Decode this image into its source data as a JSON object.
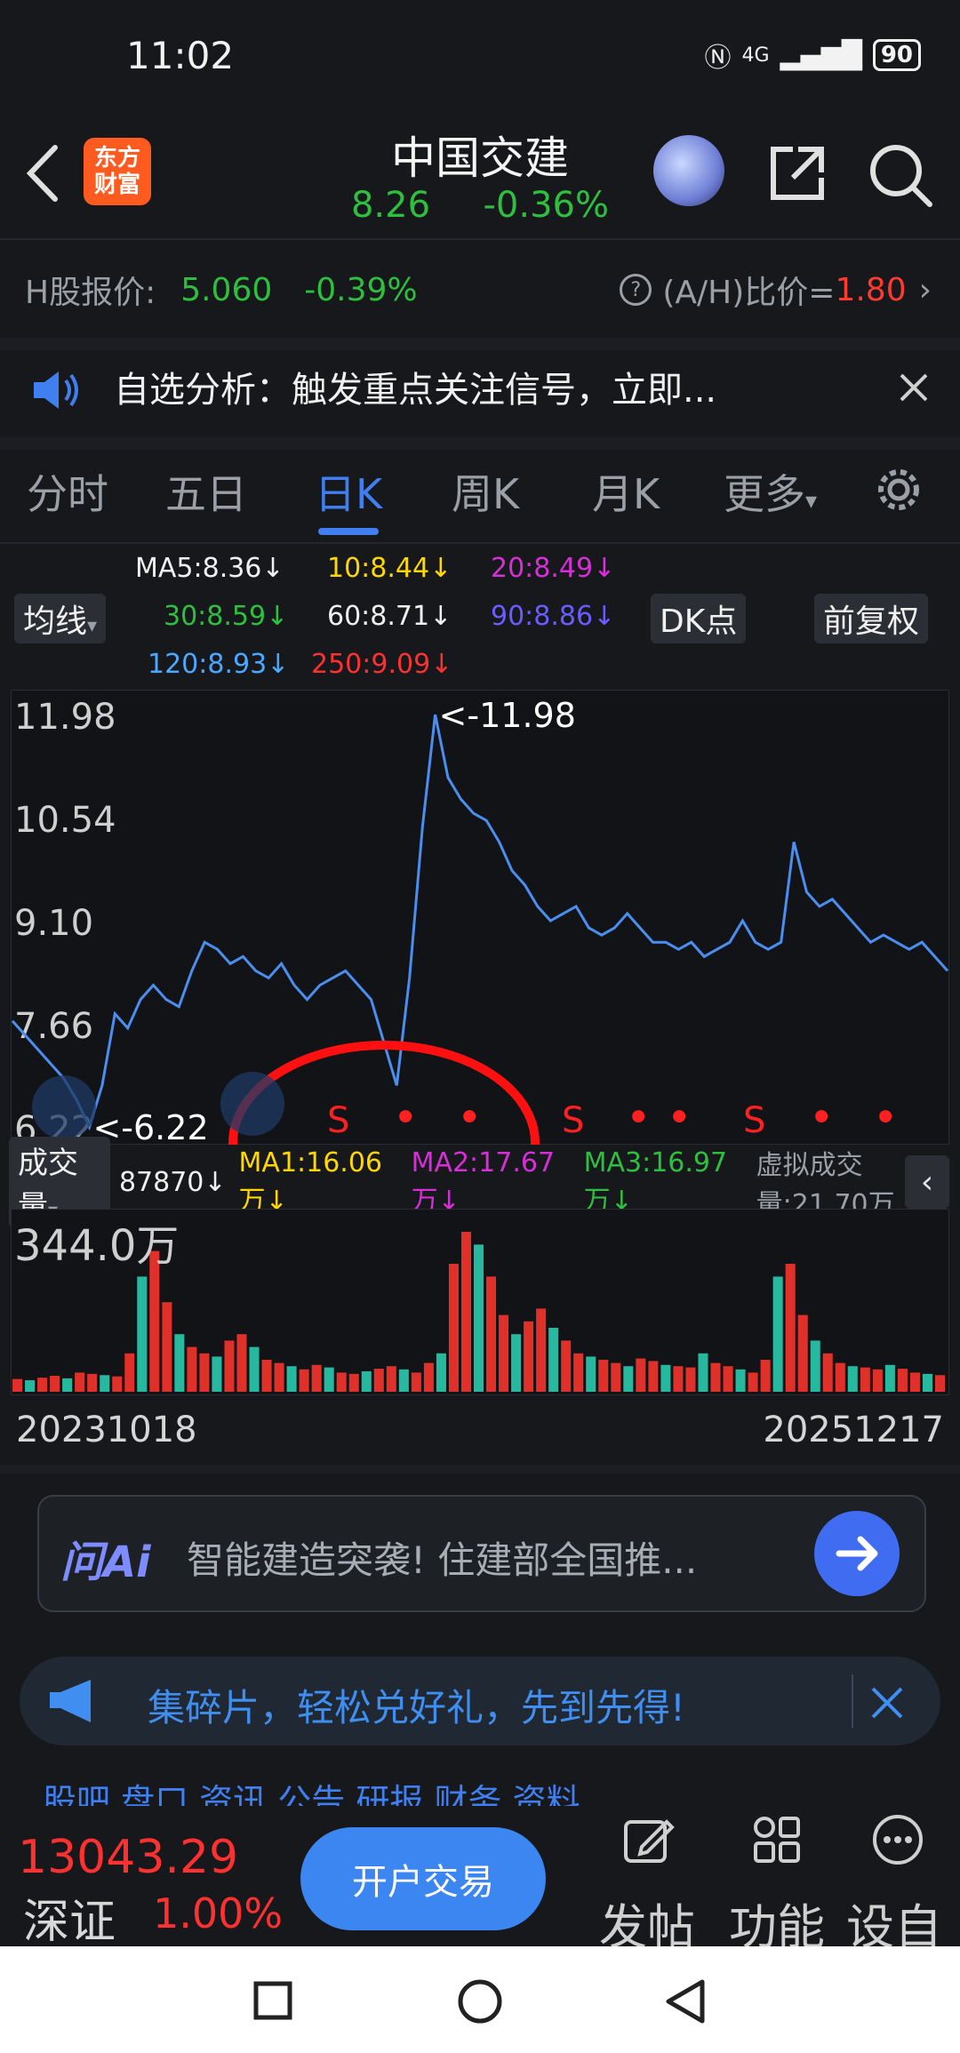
{
  "status": {
    "time": "11:02",
    "network": "4G",
    "battery": "90"
  },
  "header": {
    "logo_text": "东方财富",
    "title": "中国交建",
    "price": "8.26",
    "change": "-0.36%"
  },
  "hshare": {
    "label": "H股报价:",
    "price": "5.060",
    "change": "-0.39%",
    "ratio_label": "(A/H)比价=",
    "ratio_value": "1.80"
  },
  "notice": {
    "text": "自选分析：触发重点关注信号，立即..."
  },
  "tabs": [
    {
      "label": "分时"
    },
    {
      "label": "五日"
    },
    {
      "label": "日K"
    },
    {
      "label": "周K"
    },
    {
      "label": "月K"
    },
    {
      "label": "更多"
    }
  ],
  "ma_legend": {
    "ma5": "MA5:8.36↓",
    "ma10": "10:8.44↓",
    "ma20": "20:8.49↓",
    "ma30": "30:8.59↓",
    "ma60": "60:8.71↓",
    "ma90": "90:8.86↓",
    "ma120": "120:8.93↓",
    "ma250": "250:9.09↓",
    "junxian": "均线",
    "dk": "DK点",
    "fuquan": "前复权"
  },
  "chart_data": {
    "type": "line",
    "y_ticks": [
      "11.98",
      "10.54",
      "9.10",
      "7.66",
      "6.22"
    ],
    "ylim": [
      6.22,
      11.98
    ],
    "max_label": "<-11.98",
    "min_label": "<-6.22",
    "x_start": "20231018",
    "x_end": "20251217",
    "values": [
      7.7,
      7.5,
      7.3,
      7.1,
      6.9,
      6.6,
      6.22,
      6.8,
      7.8,
      7.6,
      8.0,
      8.2,
      8.0,
      7.9,
      8.4,
      8.8,
      8.7,
      8.5,
      8.6,
      8.4,
      8.3,
      8.5,
      8.2,
      8.0,
      8.2,
      8.3,
      8.4,
      8.2,
      8.0,
      7.4,
      6.8,
      8.3,
      10.4,
      11.98,
      11.1,
      10.8,
      10.6,
      10.5,
      10.2,
      9.8,
      9.6,
      9.3,
      9.1,
      9.2,
      9.3,
      9.0,
      8.9,
      9.0,
      9.2,
      9.0,
      8.8,
      8.8,
      8.7,
      8.8,
      8.6,
      8.7,
      8.8,
      9.1,
      8.8,
      8.7,
      8.8,
      10.2,
      9.5,
      9.3,
      9.4,
      9.2,
      9.0,
      8.8,
      8.9,
      8.8,
      8.7,
      8.8,
      8.6,
      8.4
    ],
    "signals": [
      "S",
      "•",
      "•",
      "S",
      "•",
      "•",
      "S",
      "•",
      "•"
    ],
    "volume": {
      "label": "成交量",
      "vol": "87870↓",
      "ma1": "MA1:16.06万↓",
      "ma2": "MA2:17.67万↓",
      "ma3": "MA3:16.97万↓",
      "virtual": "虚拟成交量:21.70万",
      "max_tick": "344.0万",
      "values": [
        20,
        18,
        22,
        25,
        21,
        30,
        28,
        26,
        24,
        60,
        180,
        220,
        140,
        90,
        70,
        60,
        55,
        80,
        90,
        70,
        50,
        45,
        40,
        35,
        42,
        38,
        30,
        28,
        32,
        36,
        40,
        35,
        30,
        45,
        60,
        200,
        250,
        230,
        180,
        120,
        90,
        110,
        130,
        100,
        80,
        60,
        55,
        50,
        45,
        40,
        52,
        48,
        42,
        40,
        38,
        60,
        45,
        40,
        35,
        30,
        50,
        180,
        200,
        120,
        80,
        60,
        45,
        40,
        38,
        35,
        42,
        36,
        30,
        28,
        26
      ]
    }
  },
  "ai": {
    "logo": "问Ai",
    "text": "智能建造突袭! 住建部全国推..."
  },
  "banner": {
    "text": "集碎片，轻松兑好礼，先到先得!"
  },
  "bottom": {
    "index_value": "13043.29",
    "index_name": "深证",
    "index_pct": "1.00%",
    "trade": "开户交易",
    "post": "发帖",
    "func": "功能",
    "custom": "设自",
    "partial_tabs": "股吧  盘口  资讯  公告  研报  财务  资料"
  },
  "colors": {
    "up": "#ff3b30",
    "down": "#2fbf3f",
    "accent": "#3f7ff0",
    "price_line": "#4a8ef0"
  }
}
